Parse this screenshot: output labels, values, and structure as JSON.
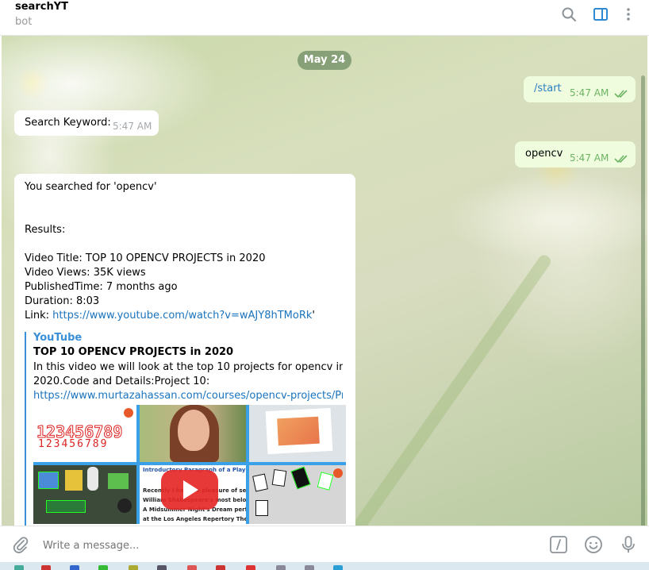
{
  "header": {
    "title": "searchYT",
    "subtitle": "bot",
    "icons": [
      "search-icon",
      "sidebar-toggle-icon",
      "more-vert-icon"
    ]
  },
  "chat": {
    "date": "May 24",
    "messages": [
      {
        "dir": "out",
        "text": "/start",
        "time": "5:47 AM",
        "status": "read"
      },
      {
        "dir": "in",
        "text": "Search Keyword:",
        "time": "5:47 AM"
      },
      {
        "dir": "out",
        "text": "opencv",
        "time": "5:47 AM",
        "status": "read"
      },
      {
        "dir": "in",
        "lines": [
          "You searched for 'opencv'",
          "Results:",
          "Video Title: TOP 10 OPENCV PROJECTS in 2020",
          "Video Views: 35K views",
          "PublishedTime: 7 months ago",
          "Duration: 8:03"
        ],
        "link_label": "Link: ",
        "link_url": "https://www.youtube.com/watch?v=wAJY8hTMoRk",
        "link_suffix": "'",
        "preview": {
          "site": "YouTube",
          "title": "TOP 10 OPENCV PROJECTS in 2020",
          "desc_line1": "In this video we will look at the top 10 projects for opencv in",
          "desc_line2": "2020.Code and Details:Project 10:",
          "desc_link": "https://www.murtazahassan.com/courses/opencv-projects/Proj...",
          "thumb_digits": "123456789",
          "thumb_doc_lines": [
            "Introductory Paragraph of a Play",
            "Recently I had the pleasure of seein",
            "William Shakespeare's most belove",
            "A Midsummer Night's Dream performe",
            "at the Los Angeles Repertory Theatre i"
          ]
        }
      }
    ]
  },
  "composer": {
    "placeholder": "Write a message...",
    "icons": [
      "attach-icon",
      "bot-command-icon",
      "emoji-icon",
      "microphone-icon"
    ]
  },
  "colors": {
    "accent": "#3a8fd6",
    "outgoing_bubble": "#effdde",
    "read_check": "#6cb463",
    "date_pill": "#7a9a6c"
  }
}
